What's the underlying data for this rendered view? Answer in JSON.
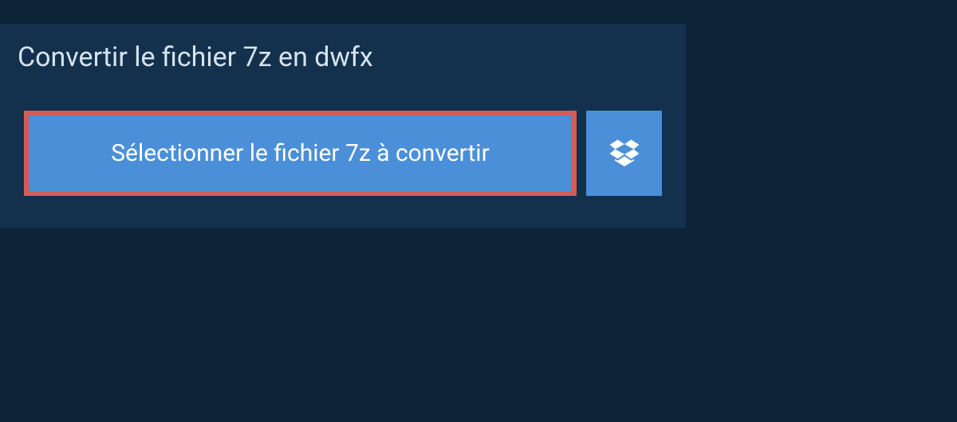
{
  "header": {
    "title": "Convertir le fichier 7z en dwfx"
  },
  "actions": {
    "select_file_label": "Sélectionner le fichier 7z à convertir"
  }
}
